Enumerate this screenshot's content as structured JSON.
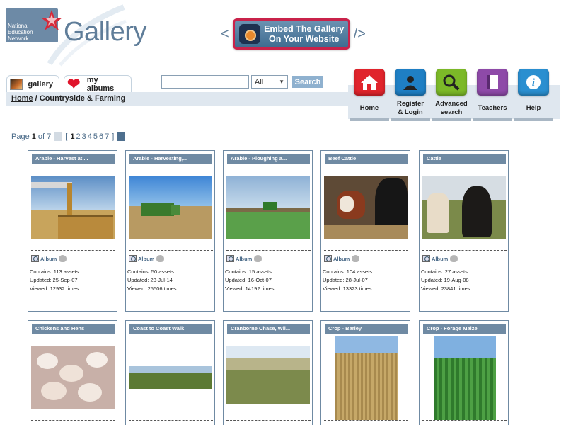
{
  "logo": {
    "text_line1": "National",
    "text_line2": "Education",
    "text_line3": "Network",
    "icon": "nen-star-logo-icon"
  },
  "header": {
    "title": "Gallery"
  },
  "embed": {
    "open": "<",
    "line1": "Embed The Gallery",
    "line2": "On Your Website",
    "close": "/>",
    "icon": "camera-icon"
  },
  "tabs": [
    {
      "label": "gallery",
      "icon": "gallery-thumbnail-icon"
    },
    {
      "label": "my albums",
      "icon": "heart-icon"
    }
  ],
  "search": {
    "value": "",
    "placeholder": "",
    "scope": "All",
    "button": "Search"
  },
  "breadcrumb": {
    "home": "Home",
    "separator": "/",
    "current": "Countryside & Farming"
  },
  "nav": [
    {
      "label": "Home",
      "icon": "home-icon",
      "color": "#e0242c"
    },
    {
      "label_line1": "Register",
      "label_line2": "& Login",
      "icon": "user-login-icon",
      "color": "#1f7fc4"
    },
    {
      "label_line1": "Advanced",
      "label_line2": "search",
      "icon": "magnifier-icon",
      "color": "#7cb928"
    },
    {
      "label": "Teachers",
      "icon": "book-icon",
      "color": "#8e4aa8"
    },
    {
      "label": "Help",
      "icon": "info-icon",
      "color": "#2a8fd0"
    }
  ],
  "pager": {
    "page_label": "Page",
    "current": "1",
    "of_label": "of",
    "total": "7",
    "open": "[",
    "pages": [
      "1",
      "2",
      "3",
      "4",
      "5",
      "6",
      "7"
    ],
    "close": "]"
  },
  "albums": [
    {
      "title": "Arable - Harvest at ...",
      "album_label": "Album",
      "contains": "Contains: 113 assets",
      "updated": "Updated: 25-Sep-07",
      "viewed": "Viewed: 12932 times"
    },
    {
      "title": "Arable - Harvesting,...",
      "album_label": "Album",
      "contains": "Contains: 50 assets",
      "updated": "Updated: 23-Jul-14",
      "viewed": "Viewed: 25506 times"
    },
    {
      "title": "Arable - Ploughing a...",
      "album_label": "Album",
      "contains": "Contains: 15 assets",
      "updated": "Updated: 16-Oct-07",
      "viewed": "Viewed: 14192 times"
    },
    {
      "title": "Beef Cattle",
      "album_label": "Album",
      "contains": "Contains: 104 assets",
      "updated": "Updated: 28-Jul-07",
      "viewed": "Viewed: 13323 times"
    },
    {
      "title": "Cattle",
      "album_label": "Album",
      "contains": "Contains: 27 assets",
      "updated": "Updated: 19-Aug-08",
      "viewed": "Viewed: 23841 times"
    },
    {
      "title": "Chickens and Hens"
    },
    {
      "title": "Coast to Coast Walk"
    },
    {
      "title": "Cranborne Chase, Wil..."
    },
    {
      "title": "Crop - Barley"
    },
    {
      "title": "Crop - Forage Maize"
    }
  ]
}
